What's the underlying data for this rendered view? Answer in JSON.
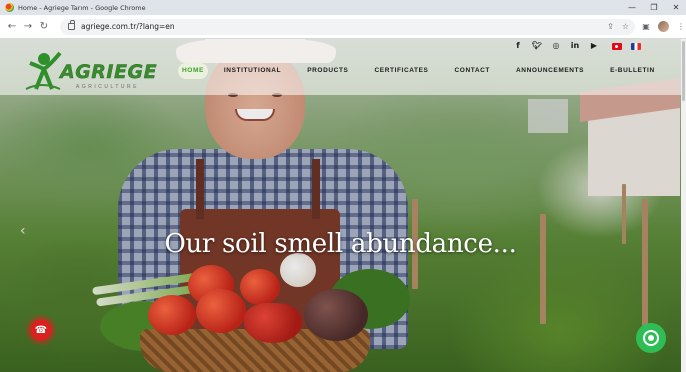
{
  "browser": {
    "window_title": "Home - Agriege Tarım - Google Chrome",
    "url": "agriege.com.tr/?lang=en",
    "controls": {
      "minimize": "—",
      "restore": "❐",
      "close": "✕"
    },
    "nav_glyphs": {
      "back": "←",
      "forward": "→",
      "reload": "↻"
    },
    "omnibox_glyphs": {
      "share": "⇪",
      "bookmark": "☆"
    },
    "toolbar_glyphs": {
      "sidepanel": "▣"
    }
  },
  "site": {
    "logo": {
      "word": "AGRIEGE",
      "sub": "AGRICULTURE",
      "brand_color": "#3a8a2f"
    },
    "nav": [
      {
        "label": "HOME",
        "active": true
      },
      {
        "label": "INSTITUTIONAL",
        "active": false
      },
      {
        "label": "PRODUCTS",
        "active": false
      },
      {
        "label": "CERTIFICATES",
        "active": false
      },
      {
        "label": "CONTACT",
        "active": false
      },
      {
        "label": "ANNOUNCEMENTS",
        "active": false
      },
      {
        "label": "E-BULLETIN",
        "active": false
      }
    ],
    "social": [
      {
        "icon": "facebook-icon",
        "glyph": "f"
      },
      {
        "icon": "twitter-icon",
        "glyph": "🐦︎"
      },
      {
        "icon": "instagram-icon",
        "glyph": "◎"
      },
      {
        "icon": "linkedin-icon",
        "glyph": "in"
      },
      {
        "icon": "youtube-icon",
        "glyph": "▶"
      }
    ],
    "languages": [
      "tr-flag-icon",
      "fr-flag-icon"
    ]
  },
  "hero": {
    "caption": "Our soil smell abundance...",
    "prev_glyph": "‹",
    "call_glyph": "☎"
  },
  "colors": {
    "accent": "#3aa02b",
    "whatsapp": "#2fbe55",
    "call": "#d9211f"
  }
}
